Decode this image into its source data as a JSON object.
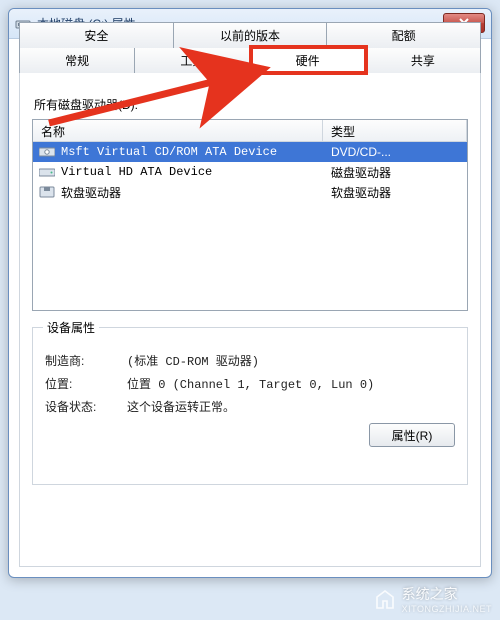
{
  "window": {
    "title": "本地磁盘 (C:) 属性"
  },
  "tabs": {
    "row1": [
      "安全",
      "以前的版本",
      "配额"
    ],
    "row2": [
      "常规",
      "工具",
      "硬件",
      "共享"
    ],
    "active": "硬件"
  },
  "list": {
    "caption": "所有磁盘驱动器(D):",
    "columns": {
      "name": "名称",
      "type": "类型"
    },
    "rows": [
      {
        "name": "Msft Virtual CD/ROM ATA Device",
        "type": "DVD/CD-...",
        "selected": true
      },
      {
        "name": "Virtual HD ATA Device",
        "type": "磁盘驱动器",
        "selected": false
      },
      {
        "name": "软盘驱动器",
        "type": "软盘驱动器",
        "selected": false
      }
    ]
  },
  "device_props": {
    "legend": "设备属性",
    "manufacturer_label": "制造商:",
    "manufacturer": "(标准 CD-ROM 驱动器)",
    "location_label": "位置:",
    "location": "位置 0 (Channel 1, Target 0, Lun 0)",
    "status_label": "设备状态:",
    "status": "这个设备运转正常。"
  },
  "buttons": {
    "properties": "属性(R)"
  },
  "watermark": {
    "text": "系统之家",
    "sub": "XITONGZHIJIA.NET"
  }
}
